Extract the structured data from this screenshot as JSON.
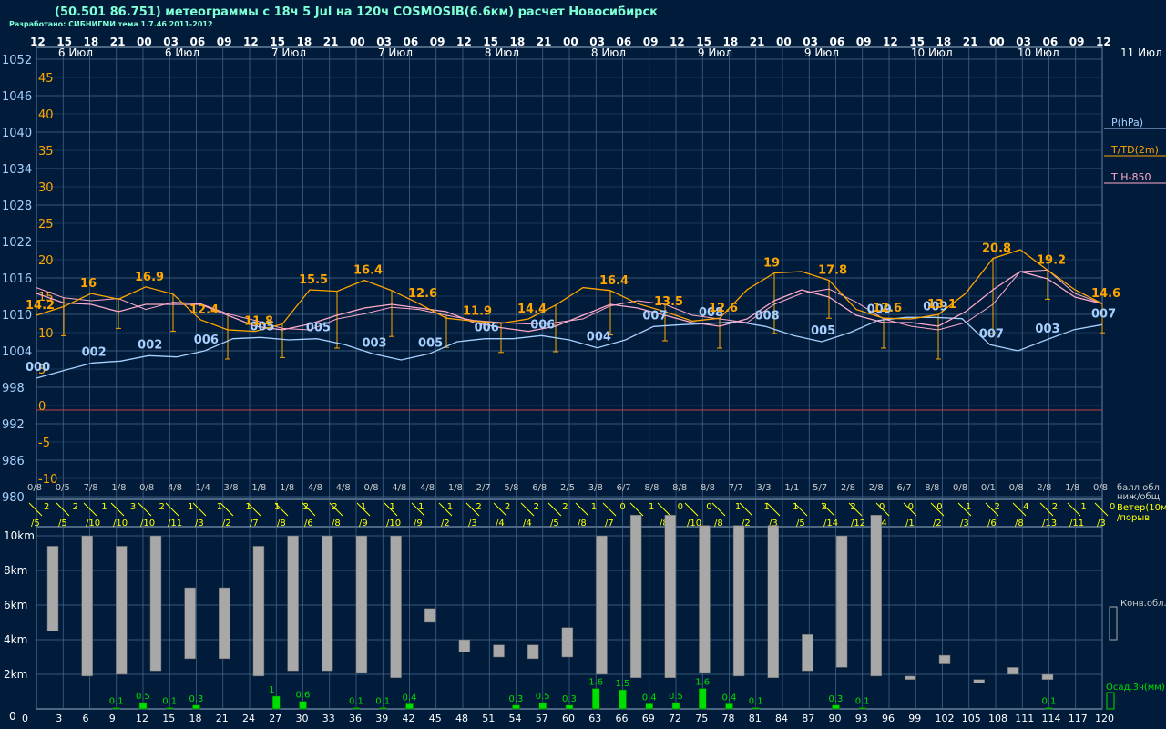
{
  "title": "(50.501 86.751) метеограммы с  18ч 5 Jul на 120ч COSMOSIB(6.6км) расчет Новосибирск",
  "subtitle": "Разработано: СИБНИГМИ тема 1.7.46 2011-2012",
  "chart_data": {
    "type": "line",
    "hours": [
      "12",
      "15",
      "18",
      "21",
      "00",
      "03",
      "06",
      "09",
      "12",
      "15",
      "18",
      "21",
      "00",
      "03",
      "06",
      "09",
      "12",
      "15",
      "18",
      "21",
      "00",
      "03",
      "06",
      "09",
      "12",
      "15",
      "18",
      "21",
      "00",
      "03",
      "06",
      "09",
      "12",
      "15",
      "18",
      "21",
      "00",
      "03",
      "06",
      "09",
      "12"
    ],
    "dates": [
      "6 Июл",
      "6 Июл",
      "7 Июл",
      "7 Июл",
      "8 Июл",
      "8 Июл",
      "9 Июл",
      "9 Июл",
      "10 Июл",
      "10 Июл",
      "11 Июл"
    ],
    "pressure_ticks": [
      "1052",
      "1046",
      "1040",
      "1034",
      "1028",
      "1022",
      "1016",
      "1010",
      "1004",
      "998",
      "992",
      "986",
      "980"
    ],
    "temp_ticks": [
      "45",
      "40",
      "35",
      "30",
      "25",
      "20",
      "15",
      "10",
      "5",
      "0",
      "-5",
      "-10"
    ],
    "legend": {
      "pressure": "P(hPa)",
      "temp": "T/TD(2m)",
      "t850": "T H-850",
      "cloud": "балл обл.",
      "cloud2": "ниж/общ",
      "wind": "Ветер(10м)",
      "gust": "/порыв",
      "conv": "Конв.обл.",
      "precip": "Осад.3ч(мм)"
    },
    "colors": {
      "pressure": "#a8d0ff",
      "temp": "#ffa500",
      "t850": "#ffaac8",
      "precip": "#00dd00",
      "cloud": "#a8a8a8",
      "wind": "#ffff00"
    },
    "pressure_hpa": [
      999.5,
      1000.8,
      1002.0,
      1002.3,
      1003.2,
      1003.0,
      1004.0,
      1006.0,
      1006.2,
      1005.8,
      1006.0,
      1005.0,
      1003.5,
      1002.5,
      1003.5,
      1005.5,
      1006.0,
      1006.0,
      1006.5,
      1005.8,
      1004.5,
      1005.8,
      1008.0,
      1008.3,
      1008.5,
      1008.8,
      1008.0,
      1006.5,
      1005.5,
      1007.0,
      1009.0,
      1009.5,
      1009.5,
      1009.3,
      1005.0,
      1004.0,
      1005.8,
      1007.5,
      1008.3
    ],
    "pressure_labels": [
      "000",
      "002",
      "002",
      "006",
      "005",
      "005",
      "003",
      "005",
      "006",
      "006",
      "004",
      "007",
      "008",
      "008",
      "005",
      "009",
      "009",
      "007",
      "003",
      "007"
    ],
    "temperature": [
      13.0,
      14.2,
      16.0,
      15.2,
      16.9,
      15.9,
      12.4,
      11.0,
      10.8,
      11.8,
      16.5,
      16.3,
      17.8,
      16.4,
      14.6,
      12.6,
      12.2,
      11.9,
      12.5,
      14.4,
      16.8,
      16.4,
      14.6,
      13.5,
      12.2,
      12.6,
      16.5,
      18.8,
      19.0,
      17.8,
      13.8,
      12.6,
      12.5,
      13.1,
      16.0,
      20.8,
      22.0,
      19.2,
      16.5,
      14.6
    ],
    "dewpoint": [
      16.8,
      15.4,
      15.0,
      15.3,
      13.8,
      14.8,
      14.6,
      13.2,
      12.3,
      11.2,
      11.0,
      12.5,
      13.2,
      14.1,
      13.8,
      13.0,
      12.3,
      12.0,
      11.8,
      12.0,
      12.5,
      14.3,
      15.0,
      14.5,
      13.0,
      12.5,
      12.0,
      14.5,
      16.0,
      16.6,
      14.8,
      12.5,
      11.5,
      11.0,
      12.0,
      14.5,
      19.0,
      19.2,
      16.0,
      14.6
    ],
    "t850": [
      16.0,
      14.7,
      14.5,
      13.5,
      14.5,
      14.5,
      14.5,
      13.0,
      11.5,
      11.0,
      11.8,
      13.0,
      14.0,
      14.5,
      14.0,
      13.5,
      12.0,
      11.3,
      10.8,
      11.5,
      13.0,
      14.5,
      14.0,
      13.0,
      12.0,
      11.5,
      12.5,
      15.0,
      16.5,
      15.5,
      13.0,
      12.0,
      12.0,
      11.5,
      13.5,
      16.5,
      19.0,
      18.0,
      15.5,
      14.6
    ],
    "temp_labels": [
      "14.2",
      "16",
      "16.9",
      "12.4",
      "11.8",
      "15.5",
      "16.4",
      "12.6",
      "11.9",
      "14.4",
      "16.4",
      "13.5",
      "12.6",
      "19",
      "17.8",
      "12.6",
      "13.1",
      "20.8",
      "19.2",
      "14.6"
    ],
    "cloud_cover": [
      "0/8",
      "0/5",
      "7/8",
      "1/8",
      "0/8",
      "4/8",
      "1/4",
      "3/8",
      "1/8",
      "1/8",
      "4/8",
      "4/8",
      "0/8",
      "4/8",
      "4/8",
      "1/8",
      "2/7",
      "5/8",
      "6/8",
      "2/5",
      "3/8",
      "6/7",
      "8/8",
      "8/8",
      "8/8",
      "7/7",
      "3/3",
      "1/1",
      "5/7",
      "2/8",
      "2/8",
      "6/7",
      "8/8",
      "0/8",
      "0/1",
      "0/8",
      "2/8",
      "1/8",
      "0/8"
    ],
    "wind_speed": [
      "2",
      "2",
      "1",
      "3",
      "2",
      "1",
      "1",
      "1",
      "1",
      "2",
      "2",
      "1",
      "1",
      "1",
      "1",
      "2",
      "2",
      "2",
      "2",
      "1",
      "0",
      "1",
      "0",
      "0",
      "1",
      "1",
      "1",
      "2",
      "2",
      "0",
      "0",
      "0",
      "1",
      "2",
      "4",
      "2",
      "1",
      "0"
    ],
    "wind_gust": [
      "/5",
      "/5",
      "/10",
      "/10",
      "/10",
      "/11",
      "/3",
      "/2",
      "/7",
      "/8",
      "/6",
      "/8",
      "/9",
      "/10",
      "/9",
      "/2",
      "/3",
      "/4",
      "/4",
      "/5",
      "/8",
      "/7",
      "/8",
      "/8",
      "/10",
      "/8",
      "/2",
      "/3",
      "/5",
      "/14",
      "/12",
      "/4",
      "/1",
      "/2",
      "/3",
      "/6",
      "/8",
      "/13",
      "/11",
      "/3"
    ],
    "cloud_tops_km_ticks": [
      "10km",
      "8km",
      "6km",
      "4km",
      "2km"
    ],
    "conv_cloud_km": [
      [
        4.5,
        9.4
      ],
      [
        1.9,
        10
      ],
      [
        2.0,
        9.4
      ],
      [
        2.2,
        10
      ],
      [
        2.9,
        7.0
      ],
      [
        2.9,
        7.0
      ],
      [
        1.9,
        9.4
      ],
      [
        2.2,
        10
      ],
      [
        2.2,
        10
      ],
      [
        2.1,
        10
      ],
      [
        1.8,
        10
      ],
      [
        5.0,
        5.8
      ],
      [
        3.3,
        4.0
      ],
      [
        3.0,
        3.7
      ],
      [
        2.9,
        3.7
      ],
      [
        3.0,
        4.7
      ],
      [
        2.0,
        10
      ],
      [
        1.8,
        11.2
      ],
      [
        1.8,
        11.2
      ],
      [
        2.1,
        10.6
      ],
      [
        1.9,
        10.6
      ],
      [
        1.8,
        10.6
      ],
      [
        2.2,
        4.3
      ],
      [
        2.4,
        10
      ],
      [
        1.9,
        11.2
      ],
      [
        1.7,
        1.9
      ],
      [
        2.6,
        3.1
      ],
      [
        1.5,
        1.7
      ],
      [
        2.0,
        2.4
      ],
      [
        1.7,
        2.0
      ]
    ],
    "precip_mm": [
      "0.1",
      "0.5",
      "0.1",
      "0.3",
      "1",
      "0.6",
      "0.1",
      "0.1",
      "0.4",
      "0.3",
      "0.5",
      "0.3",
      "1.6",
      "1.5",
      "0.4",
      "0.5",
      "1.6",
      "0.4",
      "0.1",
      "0.3",
      "0.1",
      "0.1"
    ],
    "precip_values": [
      0.1,
      0.5,
      0.1,
      0.3,
      1,
      0.6,
      0.1,
      0.1,
      0.4,
      0.3,
      0.5,
      0.3,
      1.6,
      1.5,
      0.4,
      0.5,
      1.6,
      0.4,
      0.1,
      0.3,
      0.1,
      0.1
    ],
    "precip_hours": [
      9,
      12,
      15,
      18,
      27,
      30,
      36,
      39,
      42,
      54,
      57,
      60,
      63,
      66,
      69,
      72,
      75,
      78,
      81,
      90,
      93,
      114
    ],
    "forecast_hours": [
      "0",
      "3",
      "6",
      "9",
      "12",
      "15",
      "18",
      "21",
      "24",
      "27",
      "30",
      "33",
      "36",
      "39",
      "42",
      "45",
      "48",
      "51",
      "54",
      "57",
      "60",
      "63",
      "66",
      "69",
      "72",
      "75",
      "78",
      "81",
      "84",
      "87",
      "90",
      "93",
      "96",
      "99",
      "102",
      "105",
      "108",
      "111",
      "114",
      "117",
      "120"
    ]
  }
}
